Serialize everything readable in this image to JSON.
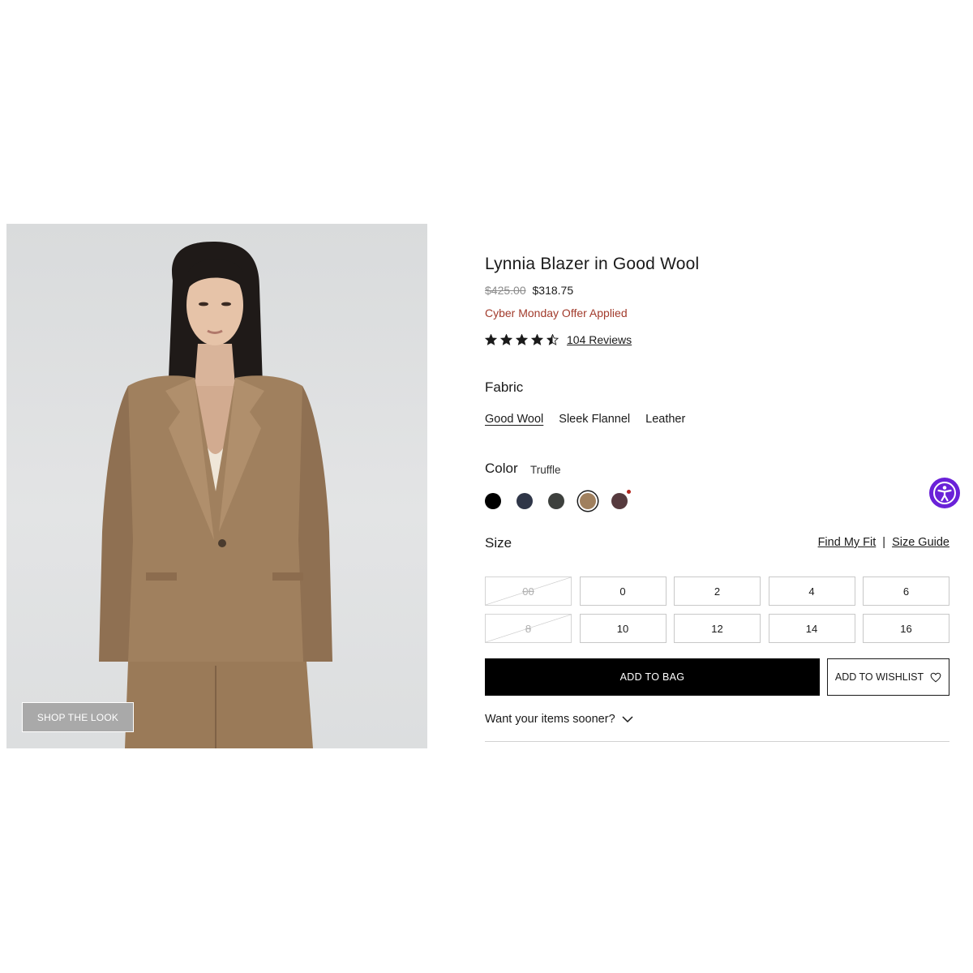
{
  "product": {
    "title": "Lynnia Blazer in Good Wool",
    "price_original": "$425.00",
    "price_sale": "$318.75",
    "offer_text": "Cyber Monday Offer Applied",
    "rating": 4.5,
    "reviews_link": "104 Reviews"
  },
  "image": {
    "shop_the_look_label": "SHOP THE LOOK"
  },
  "fabric": {
    "label": "Fabric",
    "options": [
      "Good Wool",
      "Sleek Flannel",
      "Leather"
    ],
    "selected": "Good Wool"
  },
  "color": {
    "label": "Color",
    "selected_name": "Truffle",
    "swatches": [
      {
        "hex": "#000000",
        "selected": false
      },
      {
        "hex": "#2f3648",
        "selected": false
      },
      {
        "hex": "#3d403d",
        "selected": false
      },
      {
        "hex": "#a0805e",
        "selected": true
      },
      {
        "hex": "#563a3e",
        "selected": false
      }
    ]
  },
  "size": {
    "label": "Size",
    "find_my_fit": "Find My Fit",
    "separator": "|",
    "size_guide": "Size Guide",
    "options": [
      {
        "label": "00",
        "available": false
      },
      {
        "label": "0",
        "available": true
      },
      {
        "label": "2",
        "available": true
      },
      {
        "label": "4",
        "available": true
      },
      {
        "label": "6",
        "available": true
      },
      {
        "label": "8",
        "available": false
      },
      {
        "label": "10",
        "available": true
      },
      {
        "label": "12",
        "available": true
      },
      {
        "label": "14",
        "available": true
      },
      {
        "label": "16",
        "available": true
      }
    ]
  },
  "actions": {
    "add_to_bag": "ADD TO BAG",
    "add_to_wishlist": "ADD TO WISHLIST",
    "delivery_prompt": "Want your items sooner?"
  },
  "colors": {
    "accent_offer": "#a23b2c",
    "accessibility_button": "#6a21d8",
    "blazer": "#a0805e"
  }
}
